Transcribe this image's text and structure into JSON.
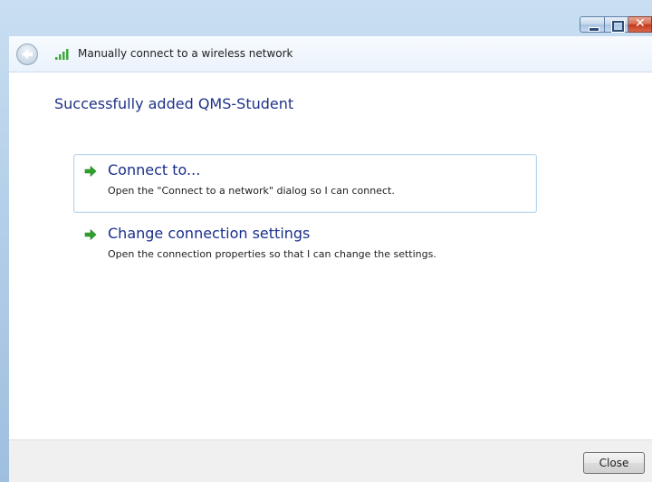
{
  "window": {
    "title": "Manually connect to a wireless network",
    "caption_buttons": [
      "minimize",
      "maximize",
      "close"
    ]
  },
  "nav": {
    "back_icon": "back-arrow-icon",
    "network_icon": "wireless-signal-icon"
  },
  "main": {
    "heading": "Successfully added QMS-Student",
    "options": [
      {
        "title": "Connect to...",
        "description": "Open the \"Connect to a network\" dialog so I can connect.",
        "icon": "green-arrow-icon"
      },
      {
        "title": "Change connection settings",
        "description": "Open the connection properties so that I can change the settings.",
        "icon": "green-arrow-icon"
      }
    ]
  },
  "footer": {
    "close_label": "Close"
  },
  "colors": {
    "heading": "#1e3287",
    "link": "#1a2f8a",
    "arrow": "#2ea12e"
  }
}
